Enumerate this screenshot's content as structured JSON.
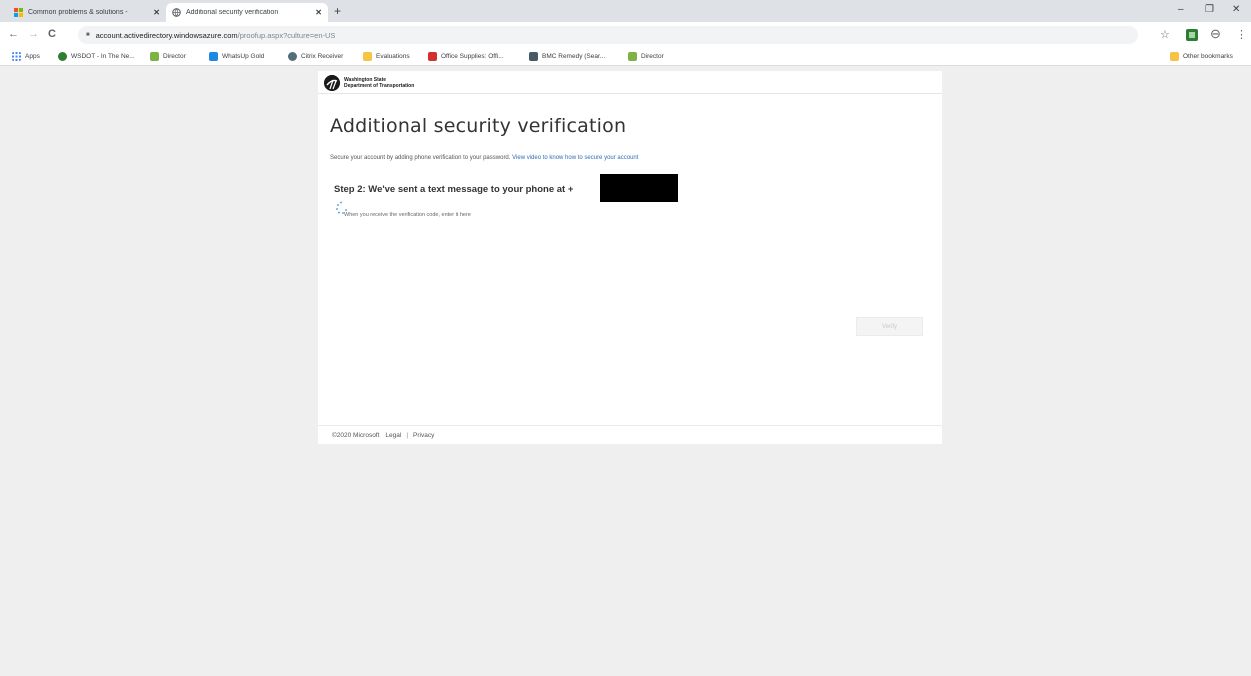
{
  "browser": {
    "tabs": [
      {
        "label": "Common problems & solutions - ",
        "close": "✕",
        "icon": "grid-favicon-icon"
      },
      {
        "label": "Additional security verification",
        "close": "✕",
        "icon": "globe-favicon-icon"
      }
    ],
    "new_tab": "+",
    "window_controls": {
      "minimize": "–",
      "restore": "❐",
      "close": "✕"
    },
    "nav": {
      "back": "←",
      "forward": "→",
      "reload": "C"
    },
    "address": {
      "lock": "■",
      "host": "account.activedirectory.windowsazure.com",
      "path": "/proofup.aspx?culture=en-US"
    },
    "toolbar_right": {
      "star": "☆",
      "profile": "⊖",
      "menu": "⋮"
    },
    "bookmarks": [
      {
        "label": "Apps",
        "color": "#4285f4"
      },
      {
        "label": "WSDOT - In The Ne...",
        "color": "#2e7d32"
      },
      {
        "label": "Director",
        "color": "#7cb342"
      },
      {
        "label": "WhatsUp Gold",
        "color": "#1e88e5"
      },
      {
        "label": "Citrix Receiver",
        "color": "#546e7a"
      },
      {
        "label": "Evaluations",
        "color": "#f6c343"
      },
      {
        "label": "Office Supplies: Offi...",
        "color": "#d32f2f"
      },
      {
        "label": "BMC Remedy (Sear...",
        "color": "#455a64"
      },
      {
        "label": "Director",
        "color": "#7cb342"
      }
    ],
    "other_bookmarks": "Other bookmarks"
  },
  "page": {
    "logo_line1": "Washington State",
    "logo_line2": "Department of Transportation",
    "title": "Additional security verification",
    "intro_text": "Secure your account by adding phone verification to your password.",
    "intro_link": "View video to know how to secure your account",
    "step_text": "Step 2: We've sent a text message to your phone at +",
    "hint": "When you receive the verification code, enter it here",
    "verify_button": "Verify",
    "footer": {
      "copyright": "©2020 Microsoft",
      "legal": "Legal",
      "separator": "|",
      "privacy": "Privacy"
    }
  }
}
